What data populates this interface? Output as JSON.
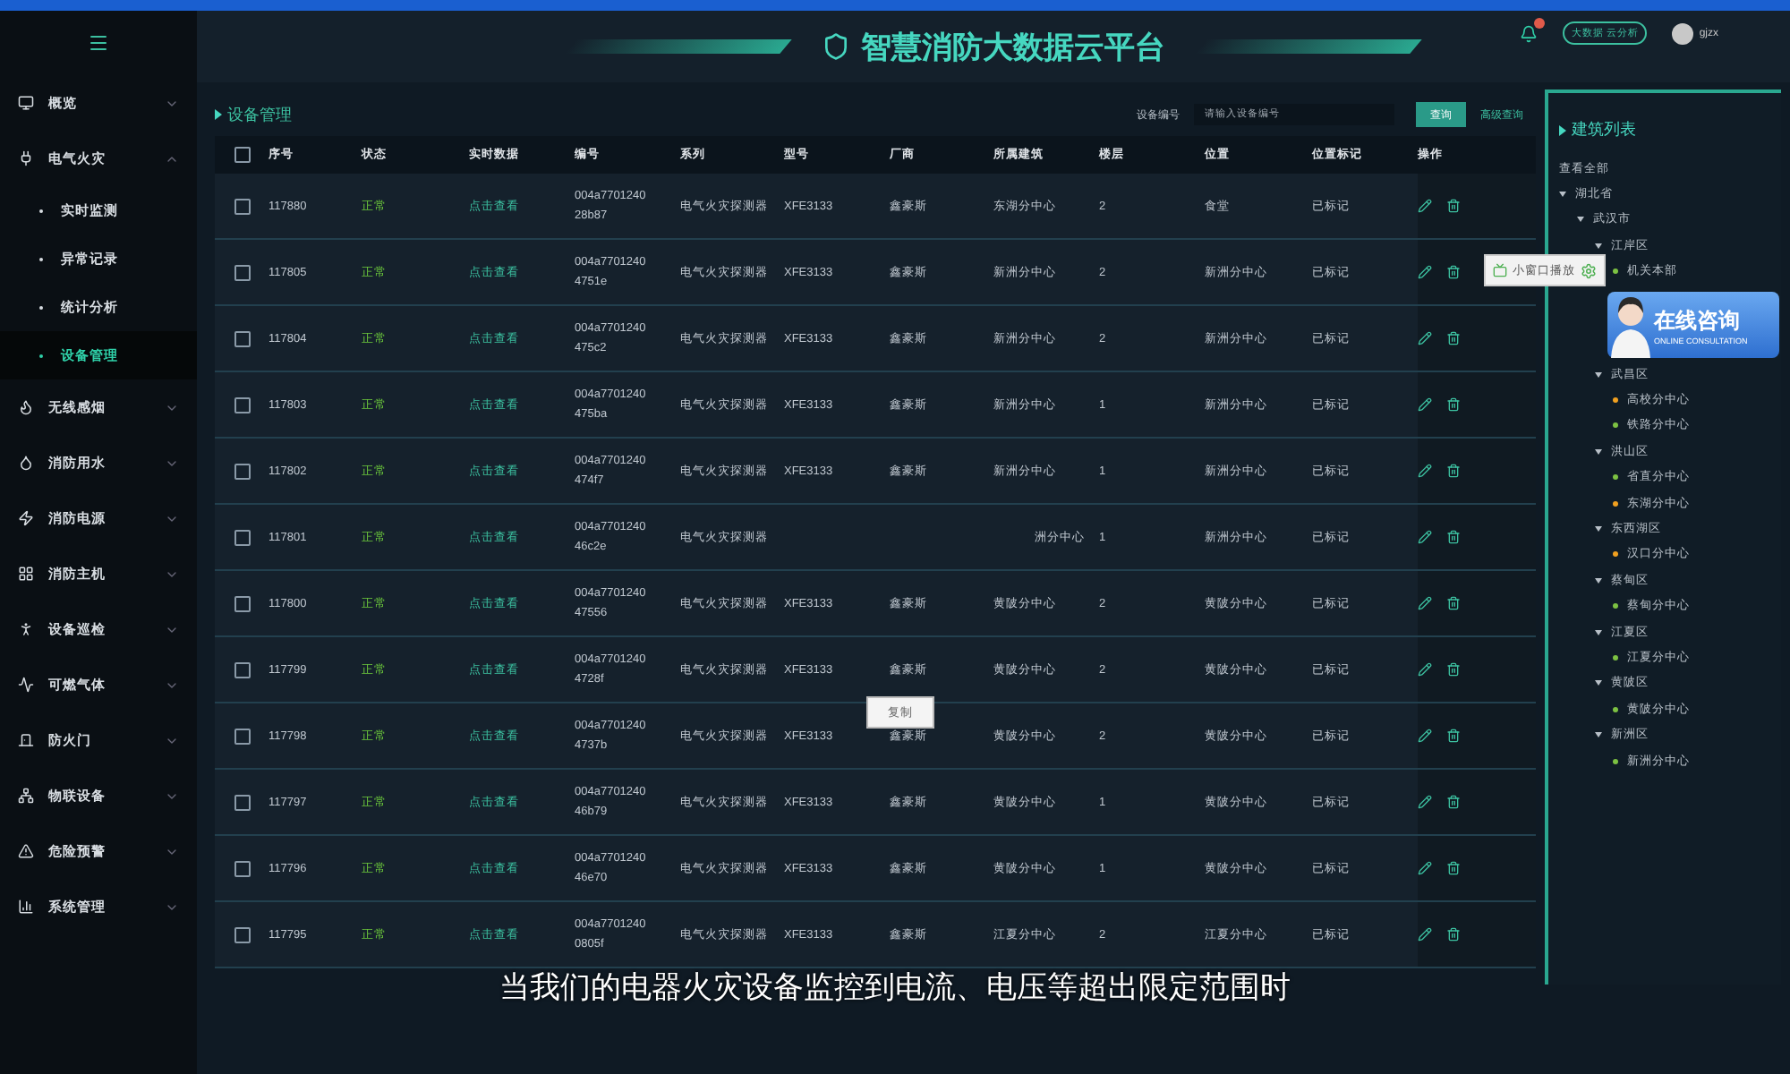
{
  "header": {
    "title": "智慧消防大数据云平台",
    "analysis_button": "大数据 云分析",
    "user": "gjzx"
  },
  "sidebar": {
    "items": [
      {
        "label": "概览",
        "expanded": false
      },
      {
        "label": "电气火灾",
        "expanded": true,
        "children": [
          {
            "label": "实时监测",
            "selected": false
          },
          {
            "label": "异常记录",
            "selected": false
          },
          {
            "label": "统计分析",
            "selected": false
          },
          {
            "label": "设备管理",
            "selected": true
          }
        ]
      },
      {
        "label": "无线感烟",
        "expanded": false
      },
      {
        "label": "消防用水",
        "expanded": false
      },
      {
        "label": "消防电源",
        "expanded": false
      },
      {
        "label": "消防主机",
        "expanded": false
      },
      {
        "label": "设备巡检",
        "expanded": false
      },
      {
        "label": "可燃气体",
        "expanded": false
      },
      {
        "label": "防火门",
        "expanded": false
      },
      {
        "label": "物联设备",
        "expanded": false
      },
      {
        "label": "危险预警",
        "expanded": false
      },
      {
        "label": "系统管理",
        "expanded": false
      }
    ]
  },
  "page_title": "设备管理",
  "search": {
    "label": "设备编号",
    "placeholder": "请输入设备编号",
    "button": "查询",
    "advanced_link": "高级查询"
  },
  "table": {
    "select_all_checked": false,
    "columns": [
      "序号",
      "状态",
      "实时数据",
      "编号",
      "系列",
      "型号",
      "厂商",
      "所属建筑",
      "楼层",
      "位置",
      "位置标记",
      "操作"
    ],
    "rows": [
      {
        "checked": false,
        "seq": "117880",
        "status": "正常",
        "realtime": "点击查看",
        "code": [
          "004a7701240",
          "28b87"
        ],
        "series": "电气火灾探测器",
        "model": "XFE3133",
        "maker": "鑫豪斯",
        "building": "东湖分中心",
        "floor": "2",
        "location": "食堂",
        "mark": "已标记"
      },
      {
        "checked": false,
        "seq": "117805",
        "status": "正常",
        "realtime": "点击查看",
        "code": [
          "004a7701240",
          "4751e"
        ],
        "series": "电气火灾探测器",
        "model": "XFE3133",
        "maker": "鑫豪斯",
        "building": "新洲分中心",
        "floor": "2",
        "location": "新洲分中心",
        "mark": "已标记"
      },
      {
        "checked": false,
        "seq": "117804",
        "status": "正常",
        "realtime": "点击查看",
        "code": [
          "004a7701240",
          "475c2"
        ],
        "series": "电气火灾探测器",
        "model": "XFE3133",
        "maker": "鑫豪斯",
        "building": "新洲分中心",
        "floor": "2",
        "location": "新洲分中心",
        "mark": "已标记"
      },
      {
        "checked": false,
        "seq": "117803",
        "status": "正常",
        "realtime": "点击查看",
        "code": [
          "004a7701240",
          "475ba"
        ],
        "series": "电气火灾探测器",
        "model": "XFE3133",
        "maker": "鑫豪斯",
        "building": "新洲分中心",
        "floor": "1",
        "location": "新洲分中心",
        "mark": "已标记"
      },
      {
        "checked": false,
        "seq": "117802",
        "status": "正常",
        "realtime": "点击查看",
        "code": [
          "004a7701240",
          "474f7"
        ],
        "series": "电气火灾探测器",
        "model": "XFE3133",
        "maker": "鑫豪斯",
        "building": "新洲分中心",
        "floor": "1",
        "location": "新洲分中心",
        "mark": "已标记"
      },
      {
        "checked": false,
        "seq": "117801",
        "status": "正常",
        "realtime": "点击查看",
        "code": [
          "004a7701240",
          "46c2e"
        ],
        "series": "电气火灾探测器",
        "building": "洲分中心",
        "floor": "1",
        "location": "新洲分中心",
        "mark": "已标记"
      },
      {
        "checked": false,
        "seq": "117800",
        "status": "正常",
        "realtime": "点击查看",
        "code": [
          "004a7701240",
          "47556"
        ],
        "series": "电气火灾探测器",
        "model": "XFE3133",
        "maker": "鑫豪斯",
        "building": "黄陂分中心",
        "floor": "2",
        "location": "黄陂分中心",
        "mark": "已标记"
      },
      {
        "checked": false,
        "seq": "117799",
        "status": "正常",
        "realtime": "点击查看",
        "code": [
          "004a7701240",
          "4728f"
        ],
        "series": "电气火灾探测器",
        "model": "XFE3133",
        "maker": "鑫豪斯",
        "building": "黄陂分中心",
        "floor": "2",
        "location": "黄陂分中心",
        "mark": "已标记"
      },
      {
        "checked": false,
        "seq": "117798",
        "status": "正常",
        "realtime": "点击查看",
        "code": [
          "004a7701240",
          "4737b"
        ],
        "series": "电气火灾探测器",
        "model": "XFE3133",
        "maker": "鑫豪斯",
        "building": "黄陂分中心",
        "floor": "2",
        "location": "黄陂分中心",
        "mark": "已标记"
      },
      {
        "checked": false,
        "seq": "117797",
        "status": "正常",
        "realtime": "点击查看",
        "code": [
          "004a7701240",
          "46b79"
        ],
        "series": "电气火灾探测器",
        "model": "XFE3133",
        "maker": "鑫豪斯",
        "building": "黄陂分中心",
        "floor": "1",
        "location": "黄陂分中心",
        "mark": "已标记"
      },
      {
        "checked": false,
        "seq": "117796",
        "status": "正常",
        "realtime": "点击查看",
        "code": [
          "004a7701240",
          "46e70"
        ],
        "series": "电气火灾探测器",
        "model": "XFE3133",
        "maker": "鑫豪斯",
        "building": "黄陂分中心",
        "floor": "1",
        "location": "黄陂分中心",
        "mark": "已标记"
      },
      {
        "checked": false,
        "seq": "117795",
        "status": "正常",
        "realtime": "点击查看",
        "code": [
          "004a7701240",
          "0805f"
        ],
        "series": "电气火灾探测器",
        "model": "XFE3133",
        "maker": "鑫豪斯",
        "building": "江夏分中心",
        "floor": "2",
        "location": "江夏分中心",
        "mark": "已标记"
      }
    ]
  },
  "building_panel": {
    "title": "建筑列表",
    "view_all": "查看全部",
    "tree": [
      {
        "label": "湖北省",
        "children": [
          {
            "label": "武汉市",
            "children": [
              {
                "label": "江岸区",
                "children": [
                  {
                    "label": "机关本部",
                    "color": "#7cc142"
                  }
                ]
              },
              {
                "label": "武昌区",
                "children": [
                  {
                    "label": "高校分中心",
                    "color": "#f0a020"
                  },
                  {
                    "label": "铁路分中心",
                    "color": "#7cc142"
                  }
                ]
              },
              {
                "label": "洪山区",
                "children": [
                  {
                    "label": "省直分中心",
                    "color": "#7cc142"
                  },
                  {
                    "label": "东湖分中心",
                    "color": "#f0a020"
                  }
                ]
              },
              {
                "label": "东西湖区",
                "children": [
                  {
                    "label": "汉口分中心",
                    "color": "#f0a020"
                  }
                ]
              },
              {
                "label": "蔡甸区",
                "children": [
                  {
                    "label": "蔡甸分中心",
                    "color": "#7cc142"
                  }
                ]
              },
              {
                "label": "江夏区",
                "children": [
                  {
                    "label": "江夏分中心",
                    "color": "#7cc142"
                  }
                ]
              },
              {
                "label": "黄陂区",
                "children": [
                  {
                    "label": "黄陂分中心",
                    "color": "#7cc142"
                  }
                ]
              },
              {
                "label": "新洲区",
                "children": [
                  {
                    "label": "新洲分中心",
                    "color": "#7cc142"
                  }
                ]
              }
            ]
          }
        ]
      }
    ]
  },
  "mini_player_popup": {
    "label": "小窗口播放"
  },
  "consult_banner": {
    "title": "在线咨询",
    "subtitle": "ONLINE CONSULTATION"
  },
  "context_menu": {
    "items": [
      "复制"
    ]
  },
  "subtitle": "当我们的电器火灾设备监控到电流、电压等超出限定范围时"
}
